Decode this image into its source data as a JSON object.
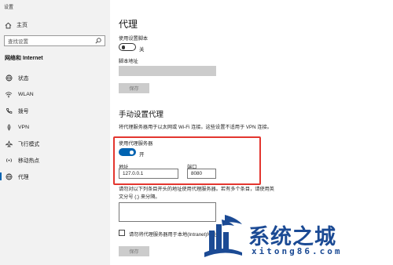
{
  "window": {
    "title": "设置"
  },
  "sidebar": {
    "home_label": "主页",
    "search_placeholder": "查找设置",
    "section_title": "网络和 Internet",
    "items": [
      {
        "label": "状态",
        "icon": "globe-icon"
      },
      {
        "label": "WLAN",
        "icon": "wifi-icon"
      },
      {
        "label": "拨号",
        "icon": "phone-icon"
      },
      {
        "label": "VPN",
        "icon": "vpn-icon"
      },
      {
        "label": "飞行模式",
        "icon": "airplane-icon"
      },
      {
        "label": "移动热点",
        "icon": "hotspot-icon"
      },
      {
        "label": "代理",
        "icon": "globe-icon",
        "active": true
      }
    ]
  },
  "main": {
    "title": "代理",
    "auto": {
      "use_script_label": "使用设置脚本",
      "toggle_state": "关",
      "script_address_label": "脚本地址",
      "save_label": "保存"
    },
    "manual": {
      "section_title": "手动设置代理",
      "description": "将代理服务器用于以太网或 Wi-Fi 连接。这些设置不适用于 VPN 连接。",
      "use_proxy_label": "使用代理服务器",
      "toggle_state": "开",
      "address_label": "地址",
      "address_value": "127.0.0.1",
      "port_label": "端口",
      "port_value": "8080",
      "exceptions_line1": "请勿对以下列条目开头的地址使用代理服务器。若有多个条目，请使用英",
      "exceptions_line2": "文分号 (;) 来分隔。",
      "checkbox_label": "请勿将代理服务器用于本地(Intranet)地址",
      "save_label": "保存"
    }
  },
  "watermark": {
    "text": "系统之城",
    "url": "xitong86.com"
  },
  "colors": {
    "accent": "#0063b1",
    "highlight": "#e3362f",
    "watermark": "#1b4a94"
  }
}
